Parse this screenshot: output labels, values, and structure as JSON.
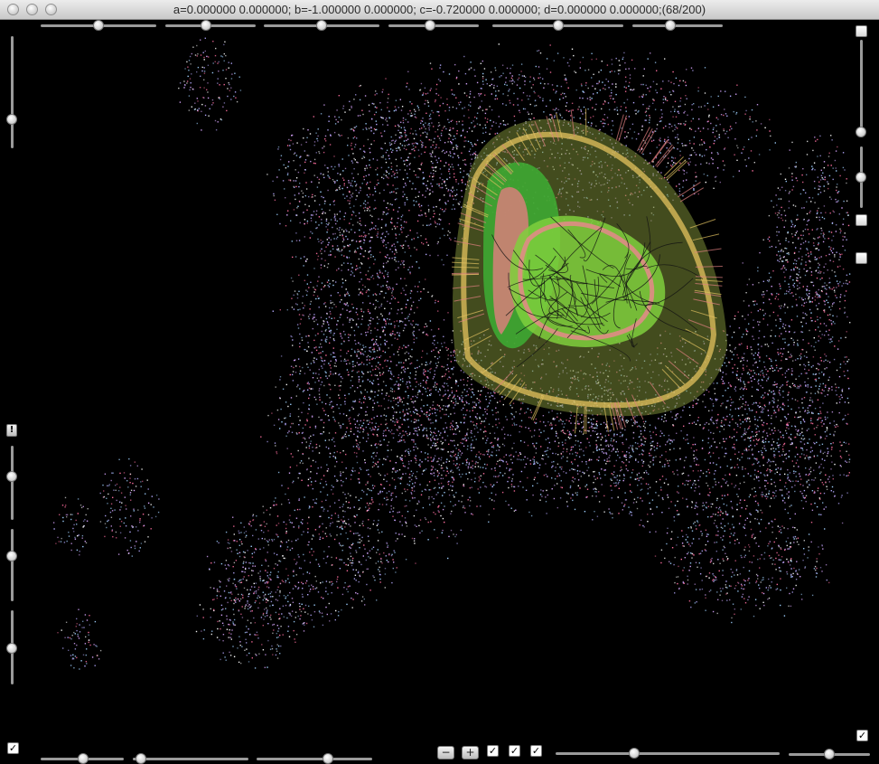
{
  "window": {
    "title": "a=0.000000 0.000000; b=-1.000000 0.000000; c=-0.720000 0.000000; d=0.000000 0.000000;(68/200)"
  },
  "controls": {
    "excl_label": "!",
    "minus_label": "−",
    "plus_label": "+",
    "check_mark": "✓"
  },
  "colors": {
    "background": "#000000",
    "point_cloud": "#b4a9ff",
    "core_green": "#6fd13a",
    "core_gold": "#e0c060",
    "core_pink": "#e08080"
  }
}
